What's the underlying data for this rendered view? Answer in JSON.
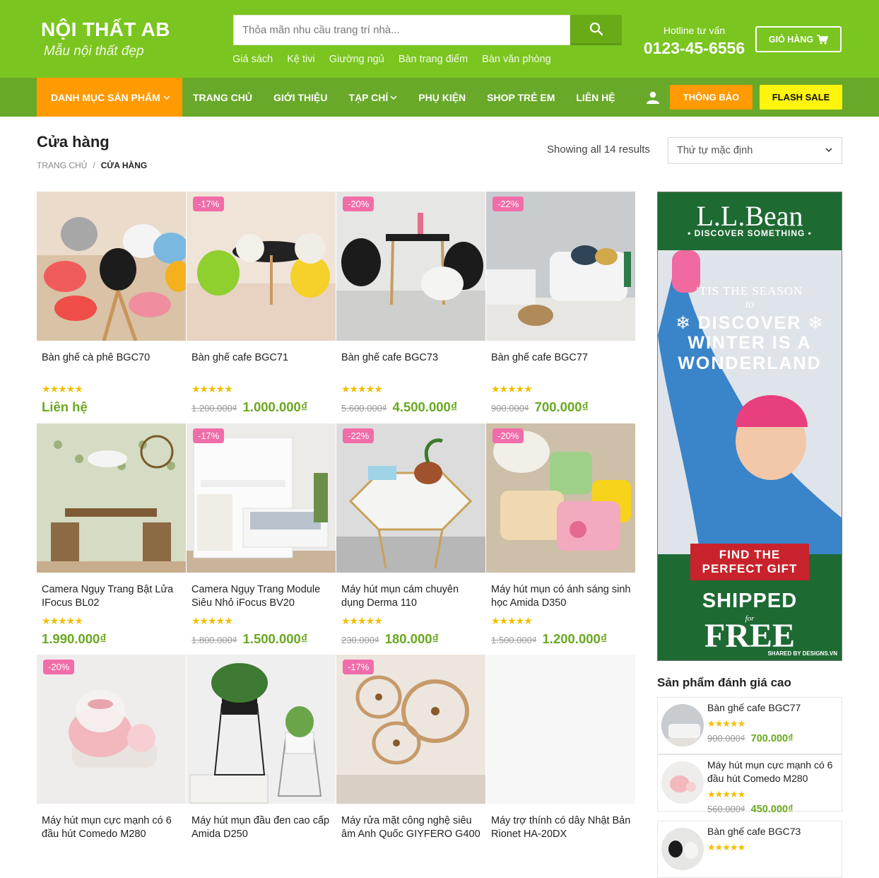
{
  "header": {
    "logo_name": "NỘI THẤT AB",
    "logo_tagline": "Mẫu nội thất đẹp",
    "search_placeholder": "Thỏa mãn nhu cầu trang trí nhà...",
    "quick_links": [
      "Giá sách",
      "Kệ tivi",
      "Giường ngủ",
      "Bàn trang điểm",
      "Bàn văn phòng"
    ],
    "hotline_label": "Hotline tư vấn",
    "hotline_number": "0123-45-6556",
    "cart_label": "GIỎ HÀNG",
    "colors": {
      "primary_green": "#7ac51f",
      "nav_green": "#69a92a",
      "orange": "#ff9a00",
      "yellow": "#fef40c",
      "price_green": "#6aa821",
      "sale_pink": "#f16da9"
    }
  },
  "nav": {
    "category_label": "DANH MỤC SẢN PHẨM",
    "items": [
      "TRANG CHỦ",
      "GIỚI THIỆU",
      "TẠP CHÍ",
      "PHỤ KIỆN",
      "SHOP TRẺ EM",
      "LIÊN HỆ"
    ],
    "notice_label": "THÔNG BÁO",
    "flash_label": "FLASH SALE"
  },
  "page": {
    "title": "Cửa hàng",
    "breadcrumb_home": "TRANG CHỦ",
    "breadcrumb_sep": "/",
    "breadcrumb_current": "CỬA HÀNG",
    "results_text": "Showing all 14 results",
    "sort_selected": "Thứ tự mặc định"
  },
  "products": [
    {
      "title": "Bàn ghế cà phê BGC70",
      "badge": "",
      "old_price": "",
      "price": "Liên hệ",
      "rating": 5
    },
    {
      "title": "Bàn ghế cafe BGC71",
      "badge": "-17%",
      "old_price": "1.200.000₫",
      "price": "1.000.000₫",
      "rating": 5
    },
    {
      "title": "Bàn ghế cafe BGC73",
      "badge": "-20%",
      "old_price": "5.600.000₫",
      "price": "4.500.000₫",
      "rating": 5
    },
    {
      "title": "Bàn ghế cafe BGC77",
      "badge": "-22%",
      "old_price": "900.000₫",
      "price": "700.000₫",
      "rating": 5
    },
    {
      "title": "Camera Ngụy Trang Bật Lửa IFocus BL02",
      "badge": "",
      "old_price": "",
      "price": "1.990.000₫",
      "rating": 5
    },
    {
      "title": "Camera Ngụy Trang Module Siêu Nhỏ iFocus BV20",
      "badge": "-17%",
      "old_price": "1.800.000₫",
      "price": "1.500.000₫",
      "rating": 5
    },
    {
      "title": "Máy hút mụn cám chuyên dụng Derma 110",
      "badge": "-22%",
      "old_price": "230.000₫",
      "price": "180.000₫",
      "rating": 5
    },
    {
      "title": "Máy hút mụn có ánh sáng sinh học Amida D350",
      "badge": "-20%",
      "old_price": "1.500.000₫",
      "price": "1.200.000₫",
      "rating": 5
    },
    {
      "title": "Máy hút mụn cực mạnh có 6 đầu hút Comedo M280",
      "badge": "-20%",
      "old_price": "",
      "price": "",
      "rating": 0
    },
    {
      "title": "Máy hút mụn đầu đen cao cấp Amida D250",
      "badge": "",
      "old_price": "",
      "price": "",
      "rating": 0
    },
    {
      "title": "Máy rửa mặt công nghệ siêu âm Anh Quốc GIYFERO G400",
      "badge": "-17%",
      "old_price": "",
      "price": "",
      "rating": 0
    },
    {
      "title": "Máy trợ thính có dây Nhật Bản Rionet HA-20DX",
      "badge": "",
      "old_price": "",
      "price": "",
      "rating": 0
    }
  ],
  "sidebar": {
    "ad": {
      "brand": "L.L.Bean",
      "sub": "• DISCOVER SOMETHING •",
      "line1": "'TIS THE SEASON",
      "line2": "to",
      "line3": "❄ DISCOVER ❄",
      "line4": "WINTER IS A",
      "line5": "WONDERLAND",
      "gift": "FIND THE PERFECT GIFT",
      "shipped": "SHIPPED",
      "for": "for",
      "free": "FREE",
      "credit": "SHARED BY DESIGNS.VN"
    },
    "widget_title": "Sản phẩm đánh giá cao",
    "top_products": [
      {
        "title": "Bàn ghế cafe BGC77",
        "old_price": "900.000₫",
        "price": "700.000₫",
        "rating": 5
      },
      {
        "title": "Máy hút mụn cực mạnh có 6 đầu hút Comedo M280",
        "old_price": "560.000₫",
        "price": "450.000₫",
        "rating": 5
      },
      {
        "title": "Bàn ghế cafe BGC73",
        "old_price": "",
        "price": "",
        "rating": 5
      }
    ]
  }
}
